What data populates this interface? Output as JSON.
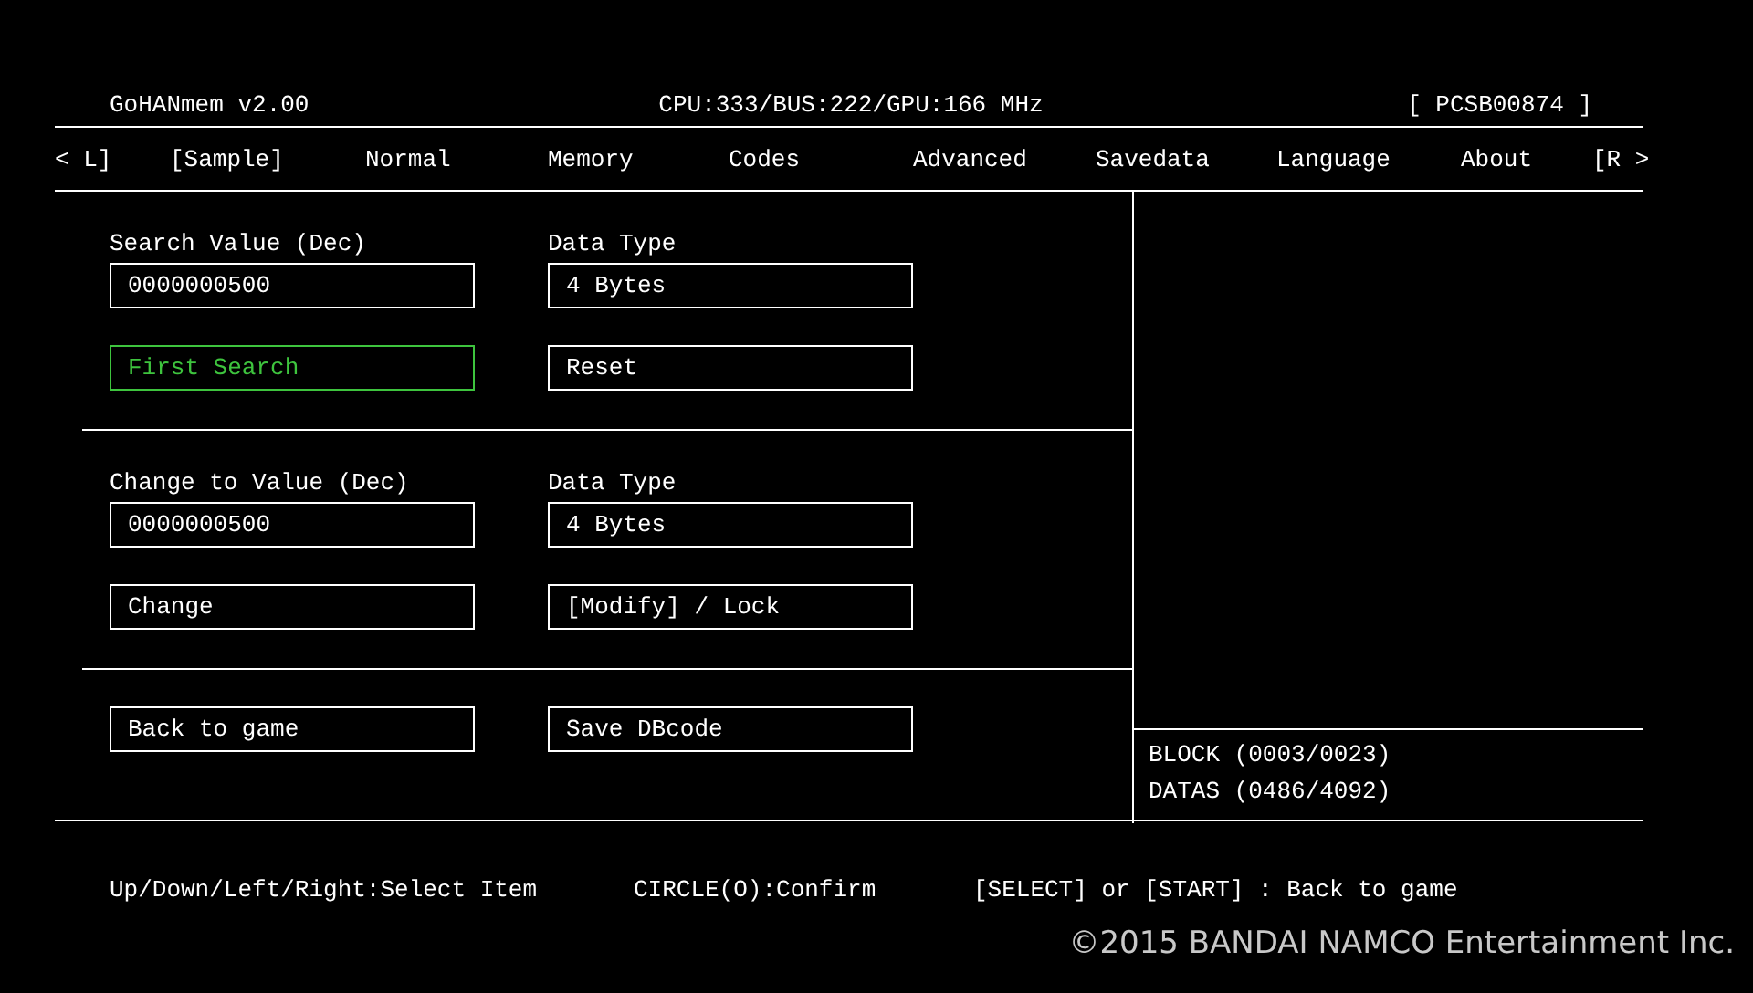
{
  "header": {
    "title": "GoHANmem v2.00",
    "clock": "CPU:333/BUS:222/GPU:166 MHz",
    "game_id": "[ PCSB00874 ]"
  },
  "tabs": [
    "< L]",
    "[Sample]",
    "Normal",
    "Memory",
    "Codes",
    "Advanced",
    "Savedata",
    "Language",
    "About",
    "[R >"
  ],
  "sections": [
    {
      "fields": [
        {
          "label": "Search Value (Dec)",
          "value": "0000000500"
        },
        {
          "label": "Data Type",
          "value": "4 Bytes"
        }
      ],
      "buttons": [
        {
          "label": "First Search",
          "focused": true
        },
        {
          "label": "Reset",
          "focused": false
        }
      ]
    },
    {
      "fields": [
        {
          "label": "Change to Value (Dec)",
          "value": "0000000500"
        },
        {
          "label": "Data Type",
          "value": "4 Bytes"
        }
      ],
      "buttons": [
        {
          "label": "Change",
          "focused": false
        },
        {
          "label": "[Modify] / Lock",
          "focused": false
        }
      ]
    },
    {
      "buttons": [
        {
          "label": "Back to game",
          "focused": false
        },
        {
          "label": "Save DBcode",
          "focused": false
        }
      ]
    }
  ],
  "status": [
    "BLOCK (0003/0023)",
    "DATAS (0486/4092)"
  ],
  "hints": [
    "Up/Down/Left/Right:Select Item",
    "CIRCLE(O):Confirm",
    "[SELECT] or [START] : Back to game"
  ],
  "copyright": "©2015 BANDAI NAMCO Entertainment Inc."
}
